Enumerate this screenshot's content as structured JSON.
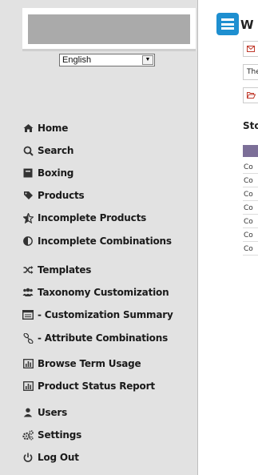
{
  "sidebar": {
    "language": {
      "selected": "English"
    },
    "items": [
      {
        "label": "Home",
        "icon": "home-icon"
      },
      {
        "label": "Search",
        "icon": "search-icon"
      },
      {
        "label": "Boxing",
        "icon": "box-icon"
      },
      {
        "label": "Products",
        "icon": "tag-icon"
      },
      {
        "label": "Incomplete Products",
        "icon": "star-half-icon"
      },
      {
        "label": "Incomplete Combinations",
        "icon": "half-circle-icon"
      },
      {
        "label": "Templates",
        "icon": "shuffle-icon"
      },
      {
        "label": "Taxonomy Customization",
        "icon": "users-icon"
      },
      {
        "label": "- Customization Summary",
        "icon": "list-alt-icon"
      },
      {
        "label": "- Attribute Combinations",
        "icon": "link-icon"
      },
      {
        "label": "Browse Term Usage",
        "icon": "bar-chart-icon"
      },
      {
        "label": "Product Status Report",
        "icon": "bar-chart-icon"
      },
      {
        "label": "Users",
        "icon": "user-icon"
      },
      {
        "label": "Settings",
        "icon": "gears-icon"
      },
      {
        "label": "Log Out",
        "icon": "power-icon"
      }
    ]
  },
  "main": {
    "title_fragment": "W",
    "notice_text": "The",
    "stock_title_fragment": "Sto",
    "stock_rows": [
      "Co",
      "Co",
      "Co",
      "Co",
      "Co",
      "Co",
      "Co"
    ],
    "accent_color": "#1e8fd0",
    "table_header_color": "#7c6f98",
    "notice_icon_color": "#c0392b"
  }
}
